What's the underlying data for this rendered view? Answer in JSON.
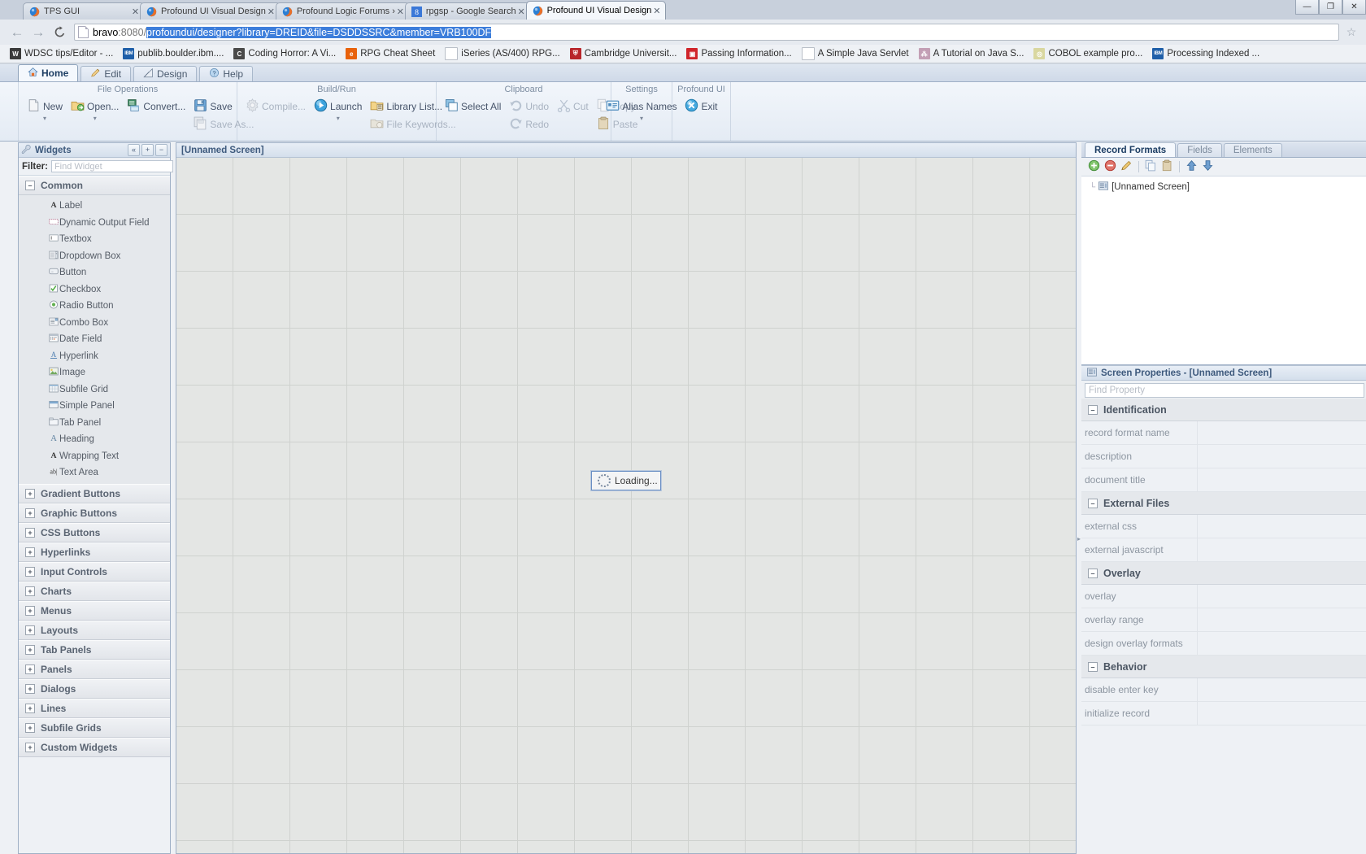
{
  "browser": {
    "tabs": [
      {
        "title": "TPS GUI",
        "icon": "profound-logo-icon",
        "active": false
      },
      {
        "title": "Profound UI Visual Design",
        "icon": "profound-logo-icon",
        "active": false
      },
      {
        "title": "Profound Logic Forums ›",
        "icon": "profound-logo-icon",
        "active": false
      },
      {
        "title": "rpgsp - Google Search",
        "icon": "google-icon",
        "active": false
      },
      {
        "title": "Profound UI Visual Design",
        "icon": "profound-logo-icon",
        "active": true
      }
    ],
    "tab_close_label": "✕",
    "window_controls": {
      "minimize": "—",
      "maximize": "❐",
      "close": "✕"
    },
    "nav": {
      "back": "←",
      "forward": "→",
      "reload": "⟳",
      "star": "☆"
    },
    "url": {
      "host": "bravo",
      "port": ":8080",
      "separator": "/",
      "selected_path": "profoundui/designer?library=DREID&file=DSDDSSRC&member=VRB100DF"
    },
    "bookmarks": [
      {
        "label": "WDSC tips/Editor - ...",
        "icon": "wdsc-icon",
        "color": "#3b3b3b",
        "glyph": "W"
      },
      {
        "label": "publib.boulder.ibm....",
        "icon": "ibm-icon",
        "color": "#1f5fa9",
        "glyph": "IBM"
      },
      {
        "label": "Coding Horror: A Vi...",
        "icon": "coding-horror-icon",
        "color": "#4a4a4a",
        "glyph": "C"
      },
      {
        "label": "RPG Cheat Sheet",
        "icon": "rpg-cheat-sheet-icon",
        "color": "#e8620c",
        "glyph": "e"
      },
      {
        "label": "iSeries (AS/400) RPG...",
        "icon": "page-icon",
        "color": "#ffffff",
        "glyph": ""
      },
      {
        "label": "Cambridge Universit...",
        "icon": "cambridge-icon",
        "color": "#b8252b",
        "glyph": "⛨"
      },
      {
        "label": "Passing Information...",
        "icon": "passing-info-icon",
        "color": "#d0252b",
        "glyph": "▣"
      },
      {
        "label": "A Simple Java Servlet",
        "icon": "page-icon",
        "color": "#ffffff",
        "glyph": ""
      },
      {
        "label": "A Tutorial on Java S...",
        "icon": "java-tutorial-icon",
        "color": "#c39fb5",
        "glyph": "⁂"
      },
      {
        "label": "COBOL example pro...",
        "icon": "cobol-icon",
        "color": "#d9d7a0",
        "glyph": "◎"
      },
      {
        "label": "Processing Indexed ...",
        "icon": "ibm-icon",
        "color": "#1f5fa9",
        "glyph": "IBM"
      }
    ]
  },
  "ribbon": {
    "tabs": [
      {
        "label": "Home",
        "icon": "home-icon",
        "active": true
      },
      {
        "label": "Edit",
        "icon": "pencil-icon",
        "active": false
      },
      {
        "label": "Design",
        "icon": "ruler-pencil-icon",
        "active": false
      },
      {
        "label": "Help",
        "icon": "help-icon",
        "active": false
      }
    ],
    "groups": [
      {
        "label": "File Operations",
        "items": [
          {
            "label": "New",
            "icon": "new-document-icon",
            "enabled": true,
            "has_caret": true
          },
          {
            "label": "Open...",
            "icon": "open-folder-icon",
            "enabled": true,
            "has_caret": true
          },
          {
            "label": "Convert...",
            "icon": "convert-icon",
            "enabled": true,
            "has_caret": false
          },
          {
            "label": "Save",
            "icon": "save-disk-icon",
            "enabled": true,
            "has_caret": false
          },
          {
            "label": "Save As...",
            "icon": "save-as-icon",
            "enabled": false,
            "has_caret": false
          }
        ]
      },
      {
        "label": "Build/Run",
        "items": [
          {
            "label": "Compile...",
            "icon": "gear-icon",
            "enabled": false,
            "has_caret": false
          },
          {
            "label": "Launch",
            "icon": "play-icon",
            "enabled": true,
            "has_caret": true
          },
          {
            "label": "Library List...",
            "icon": "library-list-icon",
            "enabled": true,
            "has_caret": false
          },
          {
            "label": "File Keywords...",
            "icon": "file-keywords-icon",
            "enabled": false,
            "has_caret": false
          }
        ]
      },
      {
        "label": "Clipboard",
        "items": [
          {
            "label": "Select All",
            "icon": "select-all-icon",
            "enabled": true,
            "has_caret": false
          },
          {
            "label": "Undo",
            "icon": "undo-icon",
            "enabled": false,
            "has_caret": false
          },
          {
            "label": "Redo",
            "icon": "redo-icon",
            "enabled": false,
            "has_caret": false
          },
          {
            "label": "Cut",
            "icon": "scissors-icon",
            "enabled": false,
            "has_caret": false
          },
          {
            "label": "Copy",
            "icon": "copy-icon",
            "enabled": false,
            "has_caret": false
          },
          {
            "label": "Paste",
            "icon": "paste-icon",
            "enabled": false,
            "has_caret": false
          }
        ]
      },
      {
        "label": "Settings",
        "items": [
          {
            "label": "Alias Names",
            "icon": "alias-names-icon",
            "enabled": true,
            "has_caret": true
          }
        ]
      },
      {
        "label": "Profound UI",
        "items": [
          {
            "label": "Exit",
            "icon": "exit-icon",
            "enabled": true,
            "has_caret": false
          }
        ]
      }
    ]
  },
  "widgets_panel": {
    "title": "Widgets",
    "title_icon": "wrench-icon",
    "header_buttons": [
      {
        "label": "«",
        "name": "collapse-button"
      },
      {
        "label": "+",
        "name": "expand-all-button"
      },
      {
        "label": "−",
        "name": "collapse-all-button"
      }
    ],
    "filter_label": "Filter:",
    "filter_placeholder": "Find Widget",
    "filter_value": "",
    "groups": [
      {
        "label": "Common",
        "expanded": true,
        "items": [
          {
            "label": "Label",
            "icon": "label-icon",
            "glyph": "A"
          },
          {
            "label": "Dynamic Output Field",
            "icon": "dynamic-output-field-icon",
            "glyph": ""
          },
          {
            "label": "Textbox",
            "icon": "textbox-icon",
            "glyph": ""
          },
          {
            "label": "Dropdown Box",
            "icon": "dropdown-box-icon",
            "glyph": ""
          },
          {
            "label": "Button",
            "icon": "button-icon",
            "glyph": ""
          },
          {
            "label": "Checkbox",
            "icon": "checkbox-icon",
            "glyph": "✓"
          },
          {
            "label": "Radio Button",
            "icon": "radio-button-icon",
            "glyph": "◉"
          },
          {
            "label": "Combo Box",
            "icon": "combo-box-icon",
            "glyph": ""
          },
          {
            "label": "Date Field",
            "icon": "date-field-icon",
            "glyph": ""
          },
          {
            "label": "Hyperlink",
            "icon": "hyperlink-icon",
            "glyph": "A"
          },
          {
            "label": "Image",
            "icon": "image-icon",
            "glyph": ""
          },
          {
            "label": "Subfile Grid",
            "icon": "subfile-grid-icon",
            "glyph": ""
          },
          {
            "label": "Simple Panel",
            "icon": "simple-panel-icon",
            "glyph": ""
          },
          {
            "label": "Tab Panel",
            "icon": "tab-panel-icon",
            "glyph": ""
          },
          {
            "label": "Heading",
            "icon": "heading-icon",
            "glyph": "A"
          },
          {
            "label": "Wrapping Text",
            "icon": "wrapping-text-icon",
            "glyph": "A"
          },
          {
            "label": "Text Area",
            "icon": "text-area-icon",
            "glyph": "ab|"
          }
        ]
      },
      {
        "label": "Gradient Buttons",
        "expanded": false,
        "items": []
      },
      {
        "label": "Graphic Buttons",
        "expanded": false,
        "items": []
      },
      {
        "label": "CSS Buttons",
        "expanded": false,
        "items": []
      },
      {
        "label": "Hyperlinks",
        "expanded": false,
        "items": []
      },
      {
        "label": "Input Controls",
        "expanded": false,
        "items": []
      },
      {
        "label": "Charts",
        "expanded": false,
        "items": []
      },
      {
        "label": "Menus",
        "expanded": false,
        "items": []
      },
      {
        "label": "Layouts",
        "expanded": false,
        "items": []
      },
      {
        "label": "Tab Panels",
        "expanded": false,
        "items": []
      },
      {
        "label": "Panels",
        "expanded": false,
        "items": []
      },
      {
        "label": "Dialogs",
        "expanded": false,
        "items": []
      },
      {
        "label": "Lines",
        "expanded": false,
        "items": []
      },
      {
        "label": "Subfile Grids",
        "expanded": false,
        "items": []
      },
      {
        "label": "Custom Widgets",
        "expanded": false,
        "items": []
      }
    ]
  },
  "canvas": {
    "title": "[Unnamed Screen]",
    "loading_label": "Loading...",
    "loading_icon": "spinner-icon"
  },
  "right_panel": {
    "tabs": [
      {
        "label": "Record Formats",
        "active": true
      },
      {
        "label": "Fields",
        "active": false
      },
      {
        "label": "Elements",
        "active": false
      }
    ],
    "toolbar": [
      {
        "name": "add-record-format-button",
        "icon": "add-green-circle-icon",
        "glyph": "+",
        "color": "#57a340"
      },
      {
        "name": "remove-record-format-button",
        "icon": "remove-red-circle-icon",
        "glyph": "−",
        "color": "#d05048"
      },
      {
        "name": "rename-record-format-button",
        "icon": "pencil-icon",
        "glyph": "✎",
        "color": "#d9a42b"
      },
      {
        "name": "copy-button",
        "icon": "copy-icon",
        "glyph": "❐",
        "color": "#8fa8c6"
      },
      {
        "name": "paste-button",
        "icon": "paste-icon",
        "glyph": "▤",
        "color": "#c6b393"
      },
      {
        "name": "move-up-button",
        "icon": "arrow-up-icon",
        "glyph": "⬆",
        "color": "#5f8dc2"
      },
      {
        "name": "move-down-button",
        "icon": "arrow-down-icon",
        "glyph": "⬇",
        "color": "#5f8dc2"
      }
    ],
    "tree": [
      {
        "label": "[Unnamed Screen]",
        "icon": "record-format-icon"
      }
    ],
    "properties": {
      "title": "Screen Properties - [Unnamed Screen]",
      "title_icon": "record-format-icon",
      "find_placeholder": "Find Property",
      "find_value": "",
      "sections": [
        {
          "label": "Identification",
          "expanded": true,
          "rows": [
            {
              "name": "record format name",
              "value": ""
            },
            {
              "name": "description",
              "value": ""
            },
            {
              "name": "document title",
              "value": ""
            }
          ]
        },
        {
          "label": "External Files",
          "expanded": true,
          "rows": [
            {
              "name": "external css",
              "value": ""
            },
            {
              "name": "external javascript",
              "value": ""
            }
          ]
        },
        {
          "label": "Overlay",
          "expanded": true,
          "rows": [
            {
              "name": "overlay",
              "value": ""
            },
            {
              "name": "overlay range",
              "value": ""
            },
            {
              "name": "design overlay formats",
              "value": ""
            }
          ]
        },
        {
          "label": "Behavior",
          "expanded": true,
          "rows": [
            {
              "name": "disable enter key",
              "value": ""
            },
            {
              "name": "initialize record",
              "value": ""
            }
          ]
        }
      ]
    }
  }
}
